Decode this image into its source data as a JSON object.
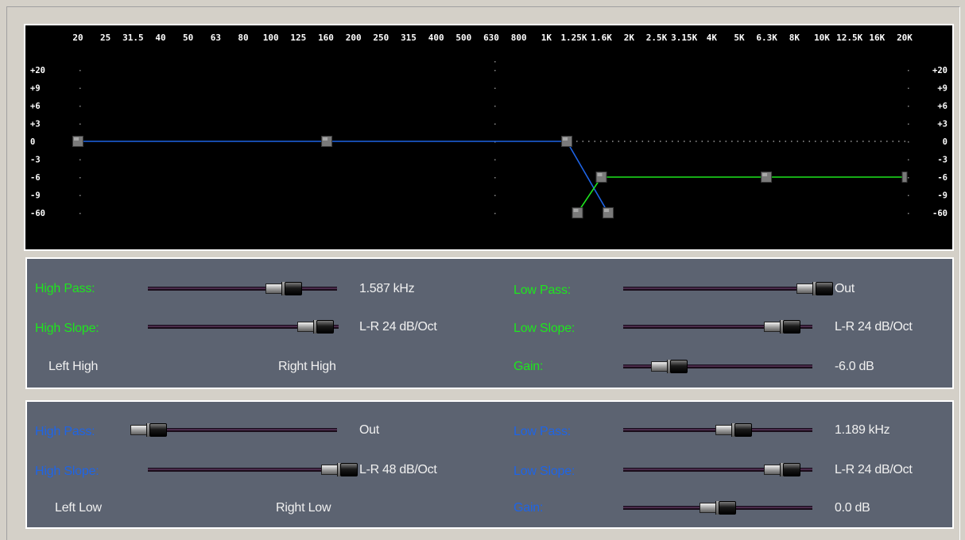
{
  "graph": {
    "freq_labels": [
      "20",
      "25",
      "31.5",
      "40",
      "50",
      "63",
      "80",
      "100",
      "125",
      "160",
      "200",
      "250",
      "315",
      "400",
      "500",
      "630",
      "800",
      "1K",
      "1.25K",
      "1.6K",
      "2K",
      "2.5K",
      "3.15K",
      "4K",
      "5K",
      "6.3K",
      "8K",
      "10K",
      "12.5K",
      "16K",
      "20K"
    ],
    "db_labels": [
      "+20",
      "+9",
      "+6",
      "+3",
      "0",
      "-3",
      "-6",
      "-9",
      "-60"
    ],
    "high_curve_color": "#1e64e6",
    "low_curve_color": "#1ee61e",
    "high_section": {
      "high_pass_hz": 1587,
      "high_slope": "L-R 24 dB/Oct",
      "low_pass": "Out",
      "low_slope": "L-R 24 dB/Oct",
      "gain_db": -6.0
    },
    "low_section": {
      "high_pass": "Out",
      "high_slope": "L-R 48 dB/Oct",
      "low_pass_hz": 1189,
      "low_slope": "L-R 24 dB/Oct",
      "gain_db": 0.0
    }
  },
  "high_panel": {
    "label_color": "#1ee61e",
    "high_pass_label": "High Pass:",
    "high_pass_value": "1.587 kHz",
    "high_slope_label": "High Slope:",
    "high_slope_value": "L-R 24 dB/Oct",
    "low_pass_label": "Low Pass:",
    "low_pass_value": "Out",
    "low_slope_label": "Low Slope:",
    "low_slope_value": "L-R 24 dB/Oct",
    "gain_label": "Gain:",
    "gain_value": "-6.0 dB",
    "left_label": "Left High",
    "right_label": "Right High",
    "sliders": {
      "high_pass": 0.72,
      "high_slope": 0.88,
      "low_pass": 0.975,
      "low_slope": 0.84,
      "gain": 0.245
    }
  },
  "low_panel": {
    "label_color": "#1e64e6",
    "high_pass_label": "High Pass:",
    "high_pass_value": "Out",
    "high_slope_label": "High Slope:",
    "high_slope_value": "L-R 48 dB/Oct",
    "low_pass_label": "Low Pass:",
    "low_pass_value": "1.189 kHz",
    "low_slope_label": "Low Slope:",
    "low_slope_value": "L-R 24 dB/Oct",
    "gain_label": "Gain:",
    "gain_value": "0.0 dB",
    "left_label": "Left Low",
    "right_label": "Right Low",
    "sliders": {
      "high_pass": 0.05,
      "high_slope": 0.975,
      "low_pass": 0.585,
      "low_slope": 0.84,
      "gain": 0.5
    }
  }
}
